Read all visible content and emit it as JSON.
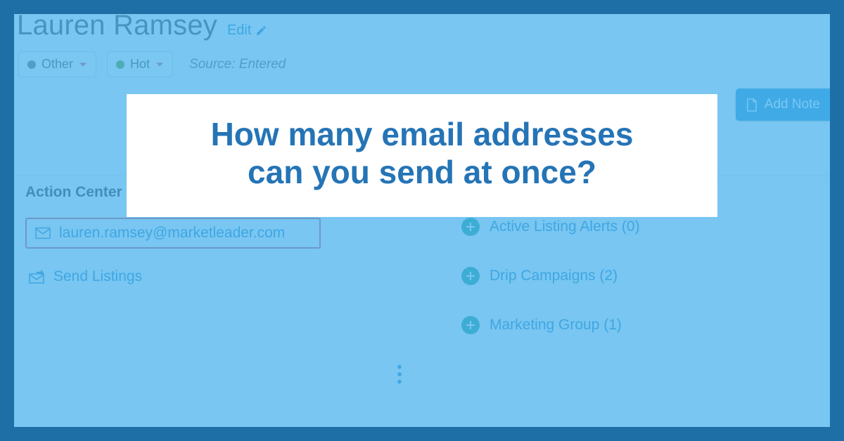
{
  "contact": {
    "name": "Lauren Ramsey",
    "edit_label": "Edit",
    "type_pill": "Other",
    "status_pill": "Hot",
    "source_label": "Source: Entered"
  },
  "buttons": {
    "add_note": "Add Note"
  },
  "action_center": {
    "title": "Action Center",
    "email": "lauren.ramsey@marketleader.com",
    "send_listings": "Send Listings",
    "items": [
      "Active Listing Alerts (0)",
      "Drip Campaigns (2)",
      "Marketing Group (1)"
    ]
  },
  "overlay": {
    "line1": "How many email addresses",
    "line2": "can you send at once?"
  }
}
